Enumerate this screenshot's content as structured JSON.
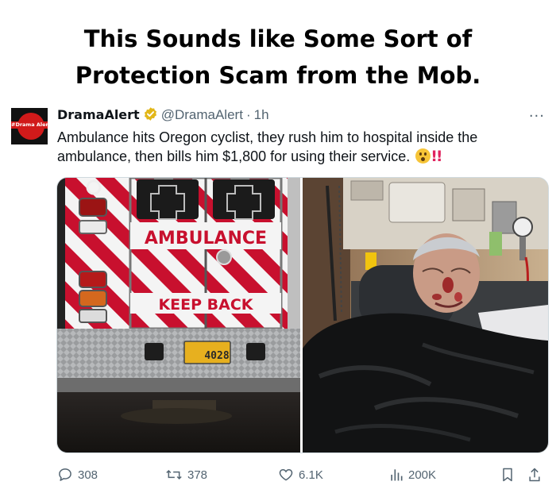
{
  "headline": {
    "line1": "This Sounds like Some Sort of",
    "line2": "Protection Scam from the Mob."
  },
  "tweet": {
    "avatar_label": "#Drama Alert",
    "display_name": "DramaAlert",
    "handle": "@DramaAlert",
    "separator": "·",
    "time": "1h",
    "more": "···",
    "text_line1": "Ambulance hits Oregon cyclist, they rush him to hospital inside the",
    "text_line2": "ambulance, then bills him $1,800 for using their service.",
    "exclaim": "!!"
  },
  "media": {
    "left_image": {
      "sign_top": "AMBULANCE",
      "sign_bottom": "KEEP BACK",
      "plate": "4028"
    },
    "right_image": {
      "subject": "injured cyclist in hospital bed"
    }
  },
  "actions": {
    "replies": "308",
    "reposts": "378",
    "likes": "6.1K",
    "views": "200K"
  },
  "colors": {
    "text": "#0f1419",
    "secondary": "#536471",
    "verified": "#e2b719",
    "ambulance_red": "#c8102e"
  }
}
